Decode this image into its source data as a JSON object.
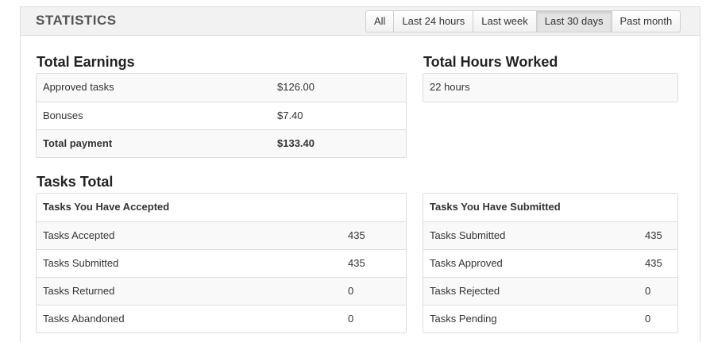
{
  "header": {
    "title": "STATISTICS",
    "filters": [
      {
        "label": "All"
      },
      {
        "label": "Last 24 hours"
      },
      {
        "label": "Last week"
      },
      {
        "label": "Last 30 days",
        "active": true
      },
      {
        "label": "Past month"
      }
    ]
  },
  "earnings": {
    "title": "Total Earnings",
    "rows": [
      {
        "label": "Approved tasks",
        "value": "$126.00"
      },
      {
        "label": "Bonuses",
        "value": "$7.40"
      },
      {
        "label": "Total payment",
        "value": "$133.40"
      }
    ]
  },
  "hours": {
    "title": "Total Hours Worked",
    "value": "22 hours"
  },
  "tasks": {
    "title": "Tasks Total",
    "accepted": {
      "header": "Tasks You Have Accepted",
      "rows": [
        {
          "label": "Tasks Accepted",
          "value": "435"
        },
        {
          "label": "Tasks Submitted",
          "value": "435"
        },
        {
          "label": "Tasks Returned",
          "value": "0"
        },
        {
          "label": "Tasks Abandoned",
          "value": "0"
        }
      ]
    },
    "submitted": {
      "header": "Tasks You Have Submitted",
      "rows": [
        {
          "label": "Tasks Submitted",
          "value": "435"
        },
        {
          "label": "Tasks Approved",
          "value": "435"
        },
        {
          "label": "Tasks Rejected",
          "value": "0"
        },
        {
          "label": "Tasks Pending",
          "value": "0"
        }
      ]
    }
  },
  "colors": {
    "header_bg": "#f2f2f2",
    "border": "#dddddd",
    "active_filter": "#e4e4e4",
    "row_shade": "#f9f9f9"
  }
}
